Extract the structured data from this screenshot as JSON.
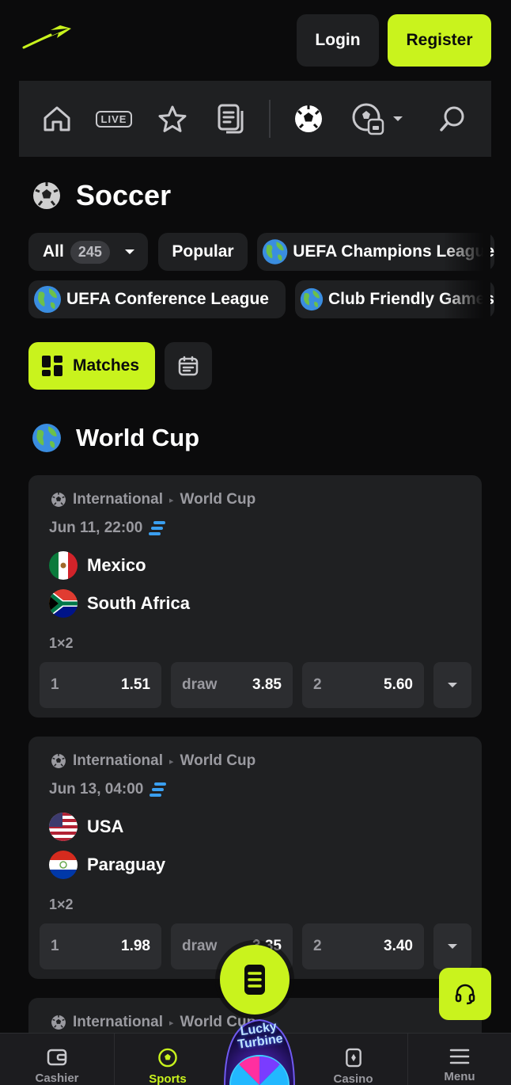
{
  "header": {
    "login_label": "Login",
    "register_label": "Register"
  },
  "nav": {
    "icons": [
      "home-icon",
      "live-icon",
      "star-icon",
      "betslip-icon",
      "soccer-icon",
      "sports-dropdown-icon",
      "search-icon"
    ],
    "live_text": "LIVE"
  },
  "sport": {
    "title": "Soccer"
  },
  "filters": {
    "all_label": "All",
    "all_count": "245",
    "popular_label": "Popular",
    "leagues": [
      "UEFA Champions League",
      "UEFA Conference League",
      "Club Friendly Games"
    ]
  },
  "view": {
    "matches_label": "Matches"
  },
  "group": {
    "title": "World Cup"
  },
  "matches": [
    {
      "region": "International",
      "league": "World Cup",
      "date": "Jun 11, 22:00",
      "home": "Mexico",
      "away": "South Africa",
      "market": "1×2",
      "odds": [
        {
          "label": "1",
          "value": "1.51"
        },
        {
          "label": "draw",
          "value": "3.85"
        },
        {
          "label": "2",
          "value": "5.60"
        }
      ]
    },
    {
      "region": "International",
      "league": "World Cup",
      "date": "Jun 13, 04:00",
      "home": "USA",
      "away": "Paraguay",
      "market": "1×2",
      "odds": [
        {
          "label": "1",
          "value": "1.98"
        },
        {
          "label": "draw",
          "value": "3.35"
        },
        {
          "label": "2",
          "value": "3.40"
        }
      ]
    },
    {
      "region": "International",
      "league": "World Cup"
    }
  ],
  "bottom_nav": {
    "cashier": "Cashier",
    "sports": "Sports",
    "casino": "Casino",
    "menu": "Menu",
    "promo": "Lucky Turbine"
  },
  "colors": {
    "accent": "#c9f31d",
    "panel": "#1f2022",
    "background": "#0b0b0c",
    "muted": "#9a9aa0"
  }
}
